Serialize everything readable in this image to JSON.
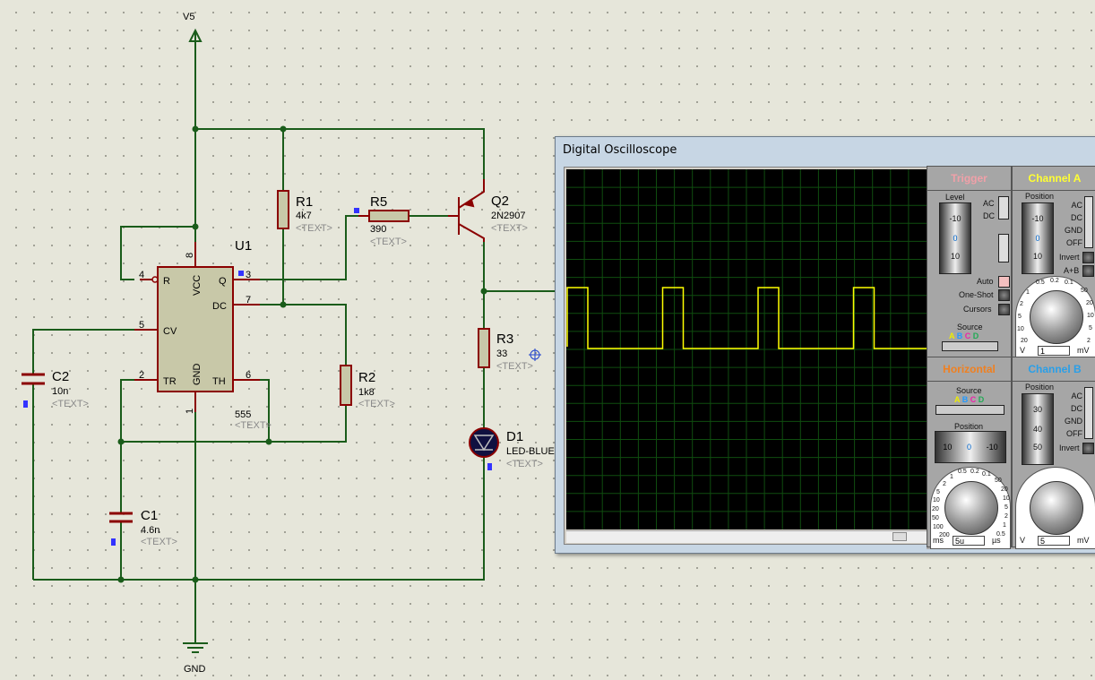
{
  "schematic": {
    "power": {
      "label": "V5"
    },
    "ground": {
      "label": "GND"
    },
    "u1": {
      "ref": "U1",
      "value": "555",
      "text": "<TEXT>",
      "pins": {
        "p1": "1",
        "p2": "2",
        "p3": "3",
        "p4": "4",
        "p5": "5",
        "p6": "6",
        "p7": "7",
        "p8": "8"
      },
      "pin_names": {
        "r": "R",
        "vcc": "VCC",
        "q": "Q",
        "dc": "DC",
        "cv": "CV",
        "tr": "TR",
        "gnd": "GND",
        "th": "TH"
      }
    },
    "r1": {
      "ref": "R1",
      "value": "4k7",
      "text": "<TEXT>"
    },
    "r2": {
      "ref": "R2",
      "value": "1k8",
      "text": "<TEXT>"
    },
    "r3": {
      "ref": "R3",
      "value": "33",
      "text": "<TEXT>"
    },
    "r5": {
      "ref": "R5",
      "value": "390",
      "text": "<TEXT>"
    },
    "c1": {
      "ref": "C1",
      "value": "4.6n",
      "text": "<TEXT>"
    },
    "c2": {
      "ref": "C2",
      "value": "10n",
      "text": "<TEXT>"
    },
    "q2": {
      "ref": "Q2",
      "value": "2N2907",
      "text": "<TEXT>"
    },
    "d1": {
      "ref": "D1",
      "value": "LED-BLUE",
      "text": "<TEXT>"
    },
    "wire_color": "#1a5c1a",
    "part_color": "#8b0000",
    "body_fill": "#c8c8a8"
  },
  "scope": {
    "title": "Digital Oscilloscope",
    "trace_color": "#ffff00",
    "grid_color": "#0f4d0f",
    "trigger": {
      "title": "Trigger",
      "level_label": "Level",
      "scale": [
        "-10",
        "0",
        "10"
      ],
      "coupling": [
        "AC",
        "DC"
      ],
      "buttons": [
        "Auto",
        "One-Shot",
        "Cursors"
      ],
      "source_label": "Source",
      "sources": [
        "A",
        "B",
        "C",
        "D"
      ]
    },
    "channel_a": {
      "title": "Channel A",
      "position_label": "Position",
      "scale": [
        "-10",
        "0",
        "10"
      ],
      "coupling": [
        "AC",
        "DC",
        "GND",
        "OFF"
      ],
      "buttons": [
        "Invert",
        "A+B"
      ],
      "dial_v": [
        "0.5",
        "0.2",
        "0.1",
        "1",
        "2",
        "5",
        "10",
        "20"
      ],
      "dial_mv": [
        "50",
        "20",
        "10",
        "5",
        "2"
      ],
      "unit_left": "V",
      "unit_right": "mV",
      "value": "1"
    },
    "horizontal": {
      "title": "Horizontal",
      "source_label": "Source",
      "sources": [
        "A",
        "B",
        "C",
        "D"
      ],
      "position_label": "Position",
      "scale": [
        "10",
        "0",
        "-10"
      ],
      "dial_left": [
        "0.5",
        "1",
        "2",
        "5",
        "10",
        "20",
        "50",
        "100",
        "200"
      ],
      "dial_right": [
        "0.2",
        "0.1",
        "50",
        "20",
        "10",
        "5",
        "2",
        "1",
        "0.5"
      ],
      "unit_left": "ms",
      "unit_right": "µs",
      "value": "5u"
    },
    "channel_b": {
      "title": "Channel B",
      "position_label": "Position",
      "scale": [
        "30",
        "40",
        "50"
      ],
      "coupling": [
        "AC",
        "DC",
        "GND",
        "OFF"
      ],
      "buttons": [
        "Invert"
      ],
      "unit_left": "V",
      "unit_right": "mV",
      "value": "5"
    }
  }
}
